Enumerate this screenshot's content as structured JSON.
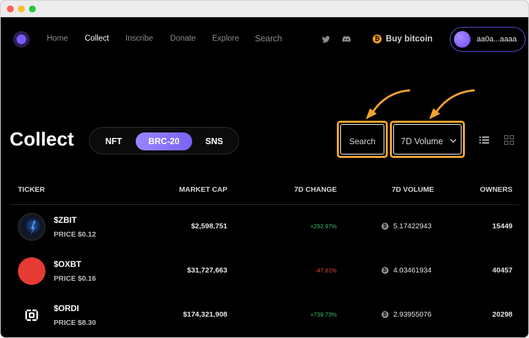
{
  "nav": {
    "links": [
      "Home",
      "Collect",
      "Inscribe",
      "Donate",
      "Explore"
    ],
    "active": "Collect",
    "search_label": "Search",
    "buy_label": "Buy bitcoin",
    "btc_glyph": "₿",
    "wallet_address": "aa0a...aaaa",
    "social": [
      "twitter-icon",
      "discord-icon"
    ]
  },
  "page": {
    "title": "Collect",
    "segments": [
      "NFT",
      "BRC-20",
      "SNS"
    ],
    "active_segment": "BRC-20",
    "search_button": "Search",
    "sort_select": "7D Volume",
    "highlight_color": "#f0a22e",
    "accent_color": "#7b62f5"
  },
  "table": {
    "headers": {
      "ticker": "TICKER",
      "market_cap": "MARKET CAP",
      "change_7d": "7D CHANGE",
      "volume_7d": "7D VOLUME",
      "owners": "OWNERS"
    },
    "rows": [
      {
        "ticker": "$ZBIT",
        "price": "PRICE $0.12",
        "market_cap": "$2,598,751",
        "change": "+292.97%",
        "direction": "up",
        "volume": "5.17422943",
        "owners": "15449",
        "icon": "zbit-logo"
      },
      {
        "ticker": "$OXBT",
        "price": "PRICE $0.16",
        "market_cap": "$31,727,663",
        "change": "-47.61%",
        "direction": "down",
        "volume": "4.03461934",
        "owners": "40457",
        "icon": "oxbt-logo"
      },
      {
        "ticker": "$ORDI",
        "price": "PRICE $8.30",
        "market_cap": "$174,321,908",
        "change": "+739.73%",
        "direction": "up",
        "volume": "2.93955076",
        "owners": "20298",
        "icon": "ordi-logo"
      }
    ]
  }
}
